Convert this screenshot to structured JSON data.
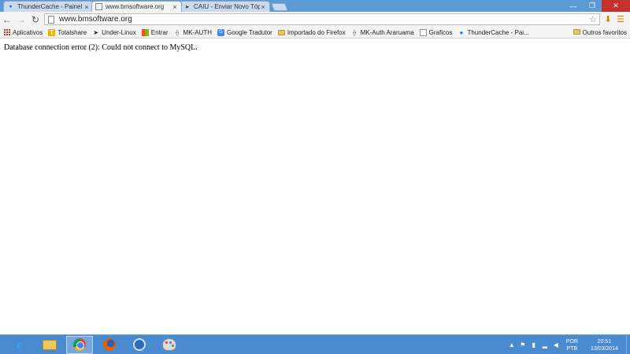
{
  "browser": {
    "tabs": [
      {
        "title": "ThunderCache - Painel de",
        "icon": "thundercache-icon",
        "active": false
      },
      {
        "title": "www.bmsoftware.org",
        "icon": "page-icon",
        "active": true
      },
      {
        "title": "CAIU - Enviar Novo Tópic",
        "icon": "underlinux-icon",
        "active": false
      }
    ],
    "window_controls": {
      "minimize": "—",
      "maximize": "❐",
      "close": "✕"
    },
    "address_bar": {
      "url": "www.bmsoftware.org"
    },
    "bookmarks": [
      {
        "label": "Aplicativos",
        "icon": "apps-icon"
      },
      {
        "label": "Totalshare",
        "icon": "totalshare-icon"
      },
      {
        "label": "Under-Linux",
        "icon": "underlinux-icon"
      },
      {
        "label": "Entrar",
        "icon": "windows-icon"
      },
      {
        "label": "MK-AUTH",
        "icon": "mkauth-icon"
      },
      {
        "label": "Google Tradutor",
        "icon": "google-translate-icon"
      },
      {
        "label": "Importado do Firefox",
        "icon": "folder-icon"
      },
      {
        "label": "MK-Auth Araruama",
        "icon": "mkauth-icon"
      },
      {
        "label": "Graficos",
        "icon": "graphics-icon"
      },
      {
        "label": "ThunderCache - Pai...",
        "icon": "thundercache-icon"
      }
    ],
    "other_bookmarks": "Outros favoritos"
  },
  "page": {
    "error_message": "Database connection error (2): Could not connect to MySQL."
  },
  "taskbar": {
    "apps": [
      {
        "name": "internet-explorer",
        "active": false
      },
      {
        "name": "file-explorer",
        "active": false
      },
      {
        "name": "chrome",
        "active": true
      },
      {
        "name": "firefox",
        "active": false
      },
      {
        "name": "thunderbird",
        "active": false
      },
      {
        "name": "paint",
        "active": false
      }
    ],
    "language_top": "POR",
    "language_bottom": "PTB",
    "time": "20:51",
    "date": "13/03/2014"
  },
  "colors": {
    "taskbar": "#4a8ad1",
    "titlebar": "#5b9bd5",
    "close_button": "#c7312b",
    "accent_orange": "#e07b00"
  }
}
